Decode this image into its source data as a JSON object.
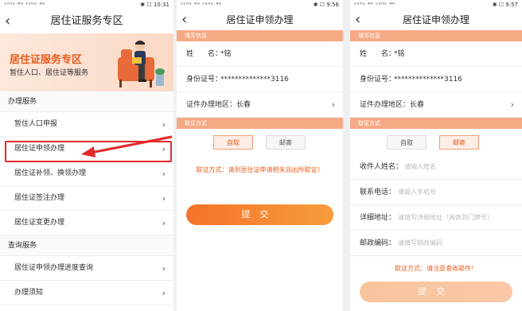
{
  "screen1": {
    "status_left": "ᵛᵒˡᵗᵉ ⁴ᴳ ᵛᵒˡᵗᵉ ⁴ᴳ",
    "status_right": "✱ ☐ 10:31",
    "title": "居住证服务专区",
    "hero_title": "居住证服务专区",
    "hero_subtitle": "暂住人口、居住证等服务",
    "section1": "办理服务",
    "items1": [
      "暂住人口申报",
      "居住证申领办理",
      "居住证补领、换领办理",
      "居住证签注办理",
      "居住证变更办理"
    ],
    "section2": "查询服务",
    "items2": [
      "居住证申领办理进度查询",
      "办理须知"
    ]
  },
  "screen2": {
    "status_right": "✱ ☐ 9:56",
    "title": "居住证申领办理",
    "section_fill": "填写信息",
    "name_label": "姓　　名：",
    "name_value": "*铭",
    "id_label": "身份证号：",
    "id_value": "**************3116",
    "area_label": "证件办理地区：",
    "area_value": "长春",
    "section_pickup": "取证方式",
    "opt_self": "自取",
    "opt_mail": "邮寄",
    "notice": "取证方式：请到居住证申请相关派出所取证！",
    "submit": "提交"
  },
  "screen3": {
    "status_right": "✱ ☐ 9:57",
    "title": "居住证申领办理",
    "section_fill": "填写信息",
    "name_label": "姓　　名：",
    "name_value": "*铭",
    "id_label": "身份证号：",
    "id_value": "**************3116",
    "area_label": "证件办理地区：",
    "area_value": "长春",
    "section_pickup": "取证方式",
    "opt_self": "自取",
    "opt_mail": "邮寄",
    "recipient_label": "收件人姓名：",
    "recipient_ph": "请输入姓名",
    "phone_label": "联系电话：",
    "phone_ph": "请输入手机号",
    "address_label": "详细地址：",
    "address_ph": "请填写详细地址（具体到门牌号）",
    "postcode_label": "邮政编码：",
    "postcode_ph": "请填写邮政编码",
    "notice": "取证方式：请注意查收邮件！",
    "submit": "提交"
  },
  "colors": {
    "accent": "#e85d1f",
    "bar": "#f6a985",
    "highlight": "#e3292a"
  }
}
